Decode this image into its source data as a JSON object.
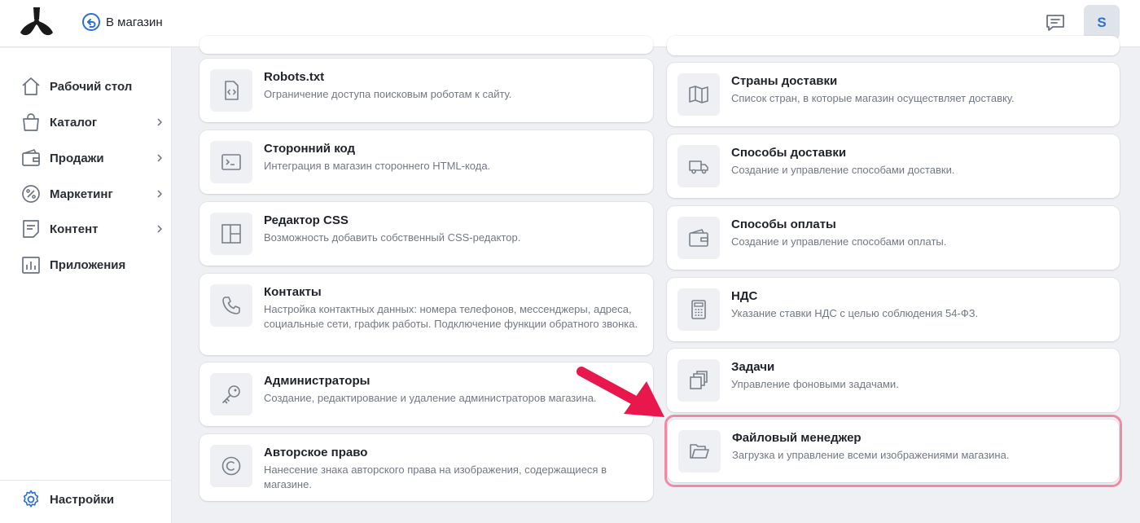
{
  "header": {
    "back_label": "В магазин",
    "avatar_initial": "S"
  },
  "sidebar": {
    "items": [
      {
        "label": "Рабочий стол",
        "icon": "home-icon"
      },
      {
        "label": "Каталог",
        "icon": "shopping-bag-icon"
      },
      {
        "label": "Продажи",
        "icon": "wallet-icon"
      },
      {
        "label": "Маркетинг",
        "icon": "percent-icon"
      },
      {
        "label": "Контент",
        "icon": "document-icon"
      },
      {
        "label": "Приложения",
        "icon": "chart-icon"
      }
    ],
    "settings_label": "Настройки"
  },
  "cards_left": [
    {
      "title": "Robots.txt",
      "desc": "Ограничение доступа поисковым роботам к сайту.",
      "icon": "code-file-icon"
    },
    {
      "title": "Сторонний код",
      "desc": "Интеграция в магазин стороннего HTML-кода.",
      "icon": "terminal-icon"
    },
    {
      "title": "Редактор CSS",
      "desc": "Возможность добавить собственный CSS-редактор.",
      "icon": "layout-icon"
    },
    {
      "title": "Контакты",
      "desc": "Настройка контактных данных: номера телефонов, мессенджеры, адреса, социальные сети, график работы. Подключение функции обратного звонка.",
      "icon": "phone-icon"
    },
    {
      "title": "Администраторы",
      "desc": "Создание, редактирование и удаление администраторов магазина.",
      "icon": "key-icon"
    },
    {
      "title": "Авторское право",
      "desc": "Нанесение знака авторского права на изображения, содержащиеся в магазине.",
      "icon": "copyright-icon"
    }
  ],
  "cards_right": [
    {
      "title": "Страны доставки",
      "desc": "Список стран, в которые магазин осуществляет доставку.",
      "icon": "map-icon"
    },
    {
      "title": "Способы доставки",
      "desc": "Создание и управление способами доставки.",
      "icon": "truck-icon"
    },
    {
      "title": "Способы оплаты",
      "desc": "Создание и управление способами оплаты.",
      "icon": "wallet-icon"
    },
    {
      "title": "НДС",
      "desc": "Указание ставки НДС с целью соблюдения 54-ФЗ.",
      "icon": "calculator-icon"
    },
    {
      "title": "Задачи",
      "desc": "Управление фоновыми задачами.",
      "icon": "layers-icon"
    },
    {
      "title": "Файловый менеджер",
      "desc": "Загрузка и управление всеми изображениями магазина.",
      "icon": "folder-icon"
    }
  ],
  "colors": {
    "accent": "#2c6fd6",
    "highlight": "#ee8aa4",
    "arrow": "#e8174c",
    "text_secondary": "#727883",
    "background": "#eef0f4"
  }
}
